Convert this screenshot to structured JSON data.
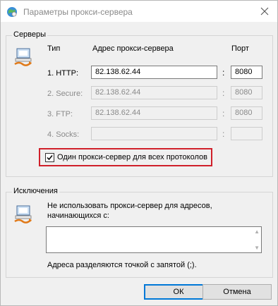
{
  "window": {
    "title": "Параметры прокси-сервера",
    "icon": "internet-options-icon",
    "close_icon": "close-icon"
  },
  "servers": {
    "group_label": "Серверы",
    "icon": "network-computer-icon",
    "col_type": "Тип",
    "col_address": "Адрес прокси-сервера",
    "col_port": "Порт",
    "rows": [
      {
        "label": "1. HTTP:",
        "address": "82.138.62.44",
        "port": "8080",
        "enabled": true
      },
      {
        "label": "2. Secure:",
        "address": "82.138.62.44",
        "port": "8080",
        "enabled": false
      },
      {
        "label": "3. FTP:",
        "address": "82.138.62.44",
        "port": "8080",
        "enabled": false
      },
      {
        "label": "4. Socks:",
        "address": "",
        "port": "",
        "enabled": false
      }
    ],
    "colon": ":",
    "same_proxy_label": "Один прокси-сервер для всех протоколов",
    "same_proxy_checked": true,
    "highlight_color": "#d0202a"
  },
  "exceptions": {
    "group_label": "Исключения",
    "icon": "network-computer-icon",
    "description": "Не использовать прокси-сервер для адресов,",
    "description_line2": "начинающихся с:",
    "value": "",
    "hint": "Адреса разделяются точкой с запятой (;)."
  },
  "buttons": {
    "ok": "ОК",
    "cancel": "Отмена"
  }
}
